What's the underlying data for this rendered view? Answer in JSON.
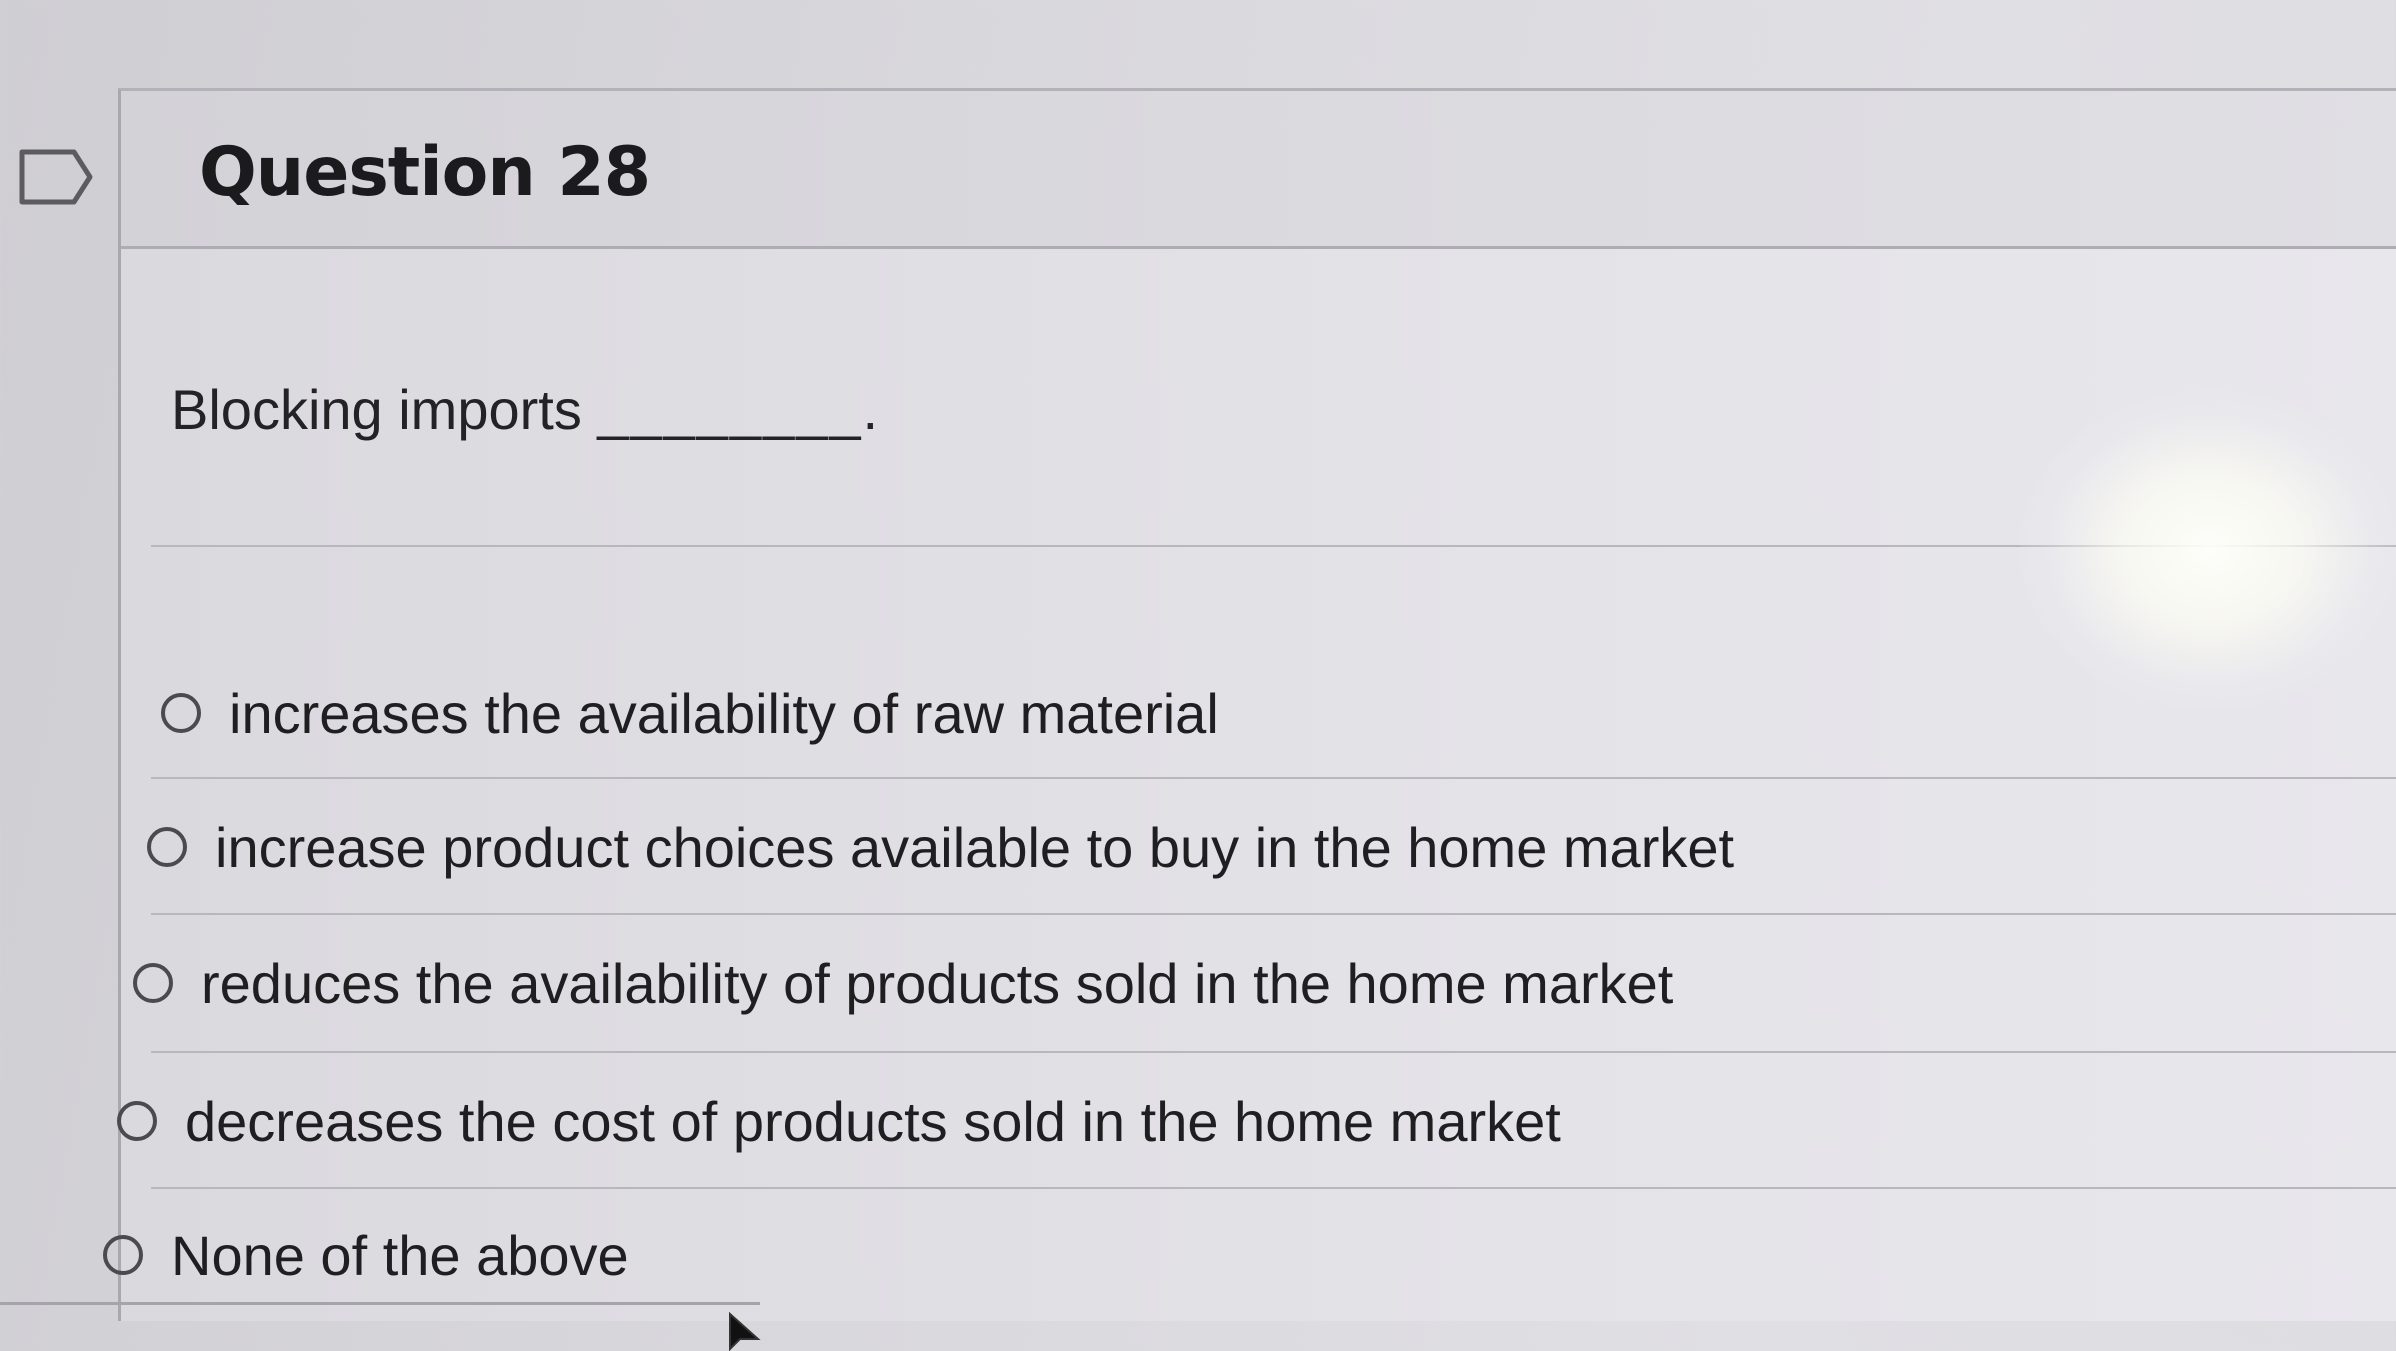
{
  "question": {
    "title": "Question 28",
    "prompt": "Blocking imports",
    "blank": "________."
  },
  "options": [
    {
      "label": "increases the availability of raw material",
      "selected": false
    },
    {
      "label": "increase product choices available to buy in the home market",
      "selected": false
    },
    {
      "label": "reduces the availability of products sold in the home market",
      "selected": false
    },
    {
      "label": "decreases the cost of products sold in the home market",
      "selected": false
    },
    {
      "label": "None of the above",
      "selected": false
    }
  ],
  "icons": {
    "flag": "flag-icon",
    "radio": "radio-icon",
    "cursor": "mouse-cursor-icon"
  },
  "colors": {
    "background": "#d9d8dd",
    "text": "#1d1d1f",
    "divider": "#b8b7bd"
  }
}
